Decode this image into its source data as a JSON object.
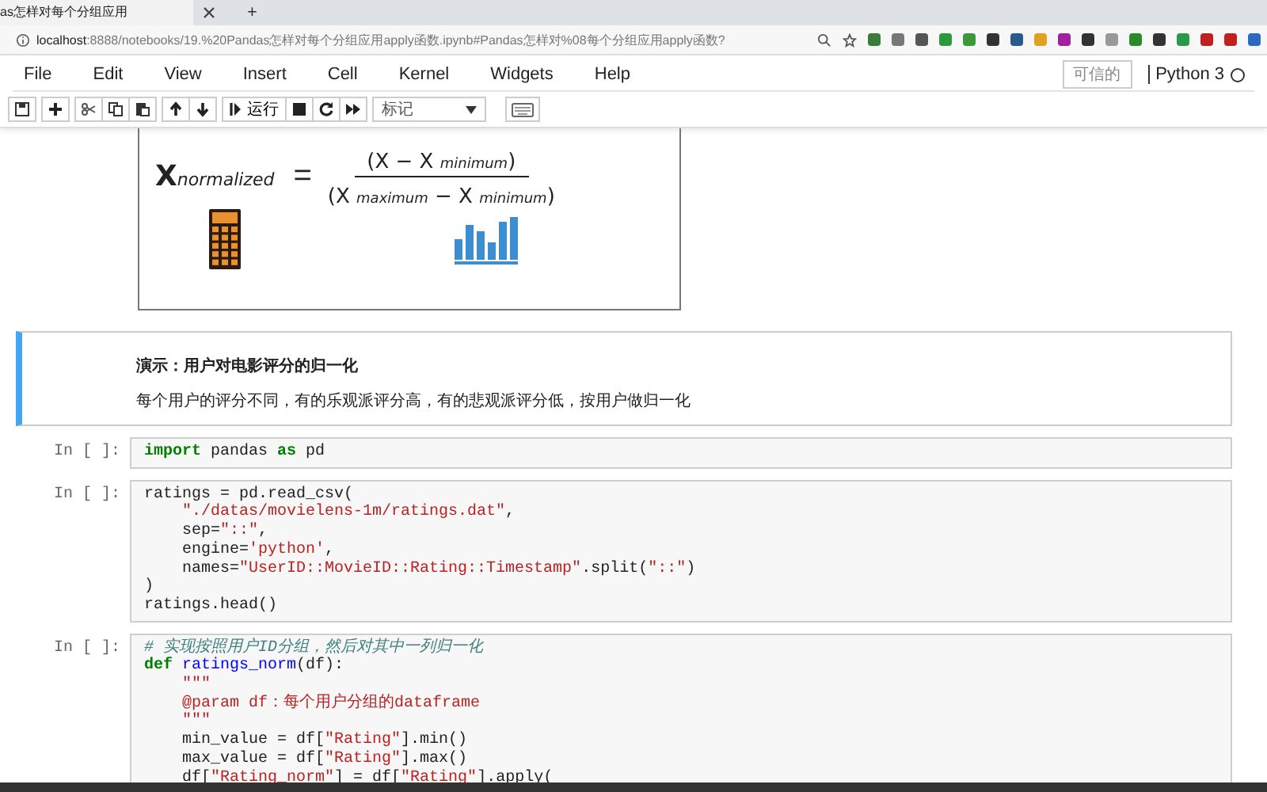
{
  "browser": {
    "tab_title": "as怎样对每个分组应用",
    "new_tab": "+",
    "url_host": "localhost",
    "url_rest": ":8888/notebooks/19.%20Pandas怎样对每个分组应用apply函数.ipynb#Pandas怎样对%08每个分组应用apply函数?"
  },
  "menu": {
    "items": [
      "File",
      "Edit",
      "View",
      "Insert",
      "Cell",
      "Kernel",
      "Widgets",
      "Help"
    ],
    "trusted": "可信的",
    "kernel": "Python 3"
  },
  "toolbar": {
    "run_label": "运行",
    "cell_type": "标记"
  },
  "formula": {
    "x": "X",
    "sub": "normalized",
    "eq": "=",
    "numerator": [
      {
        "text": "(X − X ",
        "kind": "normal"
      },
      {
        "text": "minimum",
        "kind": "subscript"
      },
      {
        "text": ")",
        "kind": "normal"
      }
    ],
    "denominator": [
      {
        "text": "(X ",
        "kind": "normal"
      },
      {
        "text": "maximum",
        "kind": "subscript"
      },
      {
        "text": " − X ",
        "kind": "normal"
      },
      {
        "text": "minimum",
        "kind": "subscript"
      },
      {
        "text": ")",
        "kind": "normal"
      }
    ]
  },
  "markdown": {
    "heading": "演示：用户对电影评分的归一化",
    "text": "每个用户的评分不同，有的乐观派评分高，有的悲观派评分低，按用户做归一化"
  },
  "cells": [
    {
      "prompt": "In [ ]:",
      "lines": [
        [
          {
            "text": "import",
            "kind": "keyword"
          },
          {
            "text": " pandas ",
            "kind": "plain"
          },
          {
            "text": "as",
            "kind": "keyword"
          },
          {
            "text": " pd",
            "kind": "plain"
          }
        ]
      ]
    },
    {
      "prompt": "In [ ]:",
      "lines": [
        [
          {
            "text": "ratings = pd.read_csv(",
            "kind": "plain"
          }
        ],
        [
          {
            "text": "    \"./datas/movielens-1m/ratings.dat\"",
            "kind": "string"
          },
          {
            "text": ",",
            "kind": "plain"
          }
        ],
        [
          {
            "text": "    sep=",
            "kind": "plain"
          },
          {
            "text": "\"::\"",
            "kind": "string"
          },
          {
            "text": ",",
            "kind": "plain"
          }
        ],
        [
          {
            "text": "    engine=",
            "kind": "plain"
          },
          {
            "text": "'python'",
            "kind": "string"
          },
          {
            "text": ",",
            "kind": "plain"
          }
        ],
        [
          {
            "text": "    names=",
            "kind": "plain"
          },
          {
            "text": "\"UserID::MovieID::Rating::Timestamp\"",
            "kind": "string"
          },
          {
            "text": ".split(",
            "kind": "plain"
          },
          {
            "text": "\"::\"",
            "kind": "string"
          },
          {
            "text": ")",
            "kind": "plain"
          }
        ],
        [
          {
            "text": ")",
            "kind": "plain"
          }
        ],
        [
          {
            "text": "ratings.head()",
            "kind": "plain"
          }
        ]
      ]
    },
    {
      "prompt": "In [ ]:",
      "lines": [
        [
          {
            "text": "# 实现按照用户ID分组，然后对其中一列归一化",
            "kind": "comment"
          }
        ],
        [
          {
            "text": "def",
            "kind": "keyword"
          },
          {
            "text": " ratings_norm",
            "kind": "function"
          },
          {
            "text": "(df):",
            "kind": "plain"
          }
        ],
        [
          {
            "text": "    \"\"\"",
            "kind": "string"
          }
        ],
        [
          {
            "text": "    @param df：每个用户分组的dataframe",
            "kind": "string"
          }
        ],
        [
          {
            "text": "    \"\"\"",
            "kind": "string"
          }
        ],
        [
          {
            "text": "    min_value = df[",
            "kind": "plain"
          },
          {
            "text": "\"Rating\"",
            "kind": "string"
          },
          {
            "text": "].min()",
            "kind": "plain"
          }
        ],
        [
          {
            "text": "    max_value = df[",
            "kind": "plain"
          },
          {
            "text": "\"Rating\"",
            "kind": "string"
          },
          {
            "text": "].max()",
            "kind": "plain"
          }
        ],
        [
          {
            "text": "    df[",
            "kind": "plain"
          },
          {
            "text": "\"Rating_norm\"",
            "kind": "string"
          },
          {
            "text": "] = df[",
            "kind": "plain"
          },
          {
            "text": "\"Rating\"",
            "kind": "string"
          },
          {
            "text": "].apply(",
            "kind": "plain"
          }
        ]
      ]
    }
  ]
}
